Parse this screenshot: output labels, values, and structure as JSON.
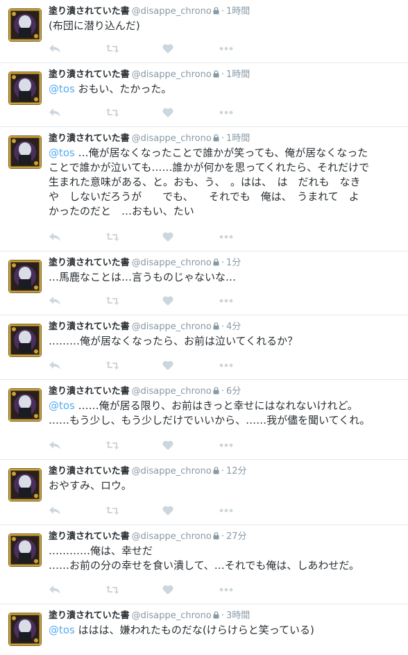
{
  "user": {
    "fullname": "塗り潰されていた書",
    "screenname": "@disappe_chrono"
  },
  "separator": "·",
  "colors": {
    "link": "#55acee",
    "meta": "#8899a6",
    "action_icon": "#ccd6dd",
    "divider": "#e1e8ed",
    "text": "#292f33"
  },
  "icons": [
    "lock-icon",
    "reply-icon",
    "retweet-icon",
    "like-icon",
    "more-icon"
  ],
  "tweets": [
    {
      "time": "1時間",
      "mention": "",
      "text": "(布団に潜り込んだ)"
    },
    {
      "time": "1時間",
      "mention": "@tos",
      "text": " おもい、たかった。"
    },
    {
      "time": "1時間",
      "mention": "@tos",
      "text": " …俺が居なくなったことで誰かが笑っても、俺が居なくなった\nことで誰かが泣いても……誰かが何かを思ってくれたら、それだけで\n生まれた意味がある、と。おも、う、　。はは、　は　だれも　なき\nや　しないだろうが　　でも、　　それでも　俺は、　うまれて　よ\nかったのだと　…おもい、たい"
    },
    {
      "time": "1分",
      "mention": "",
      "text": "…馬鹿なことは…言うものじゃないな…"
    },
    {
      "time": "4分",
      "mention": "",
      "text": "………俺が居なくなったら、お前は泣いてくれるか？"
    },
    {
      "time": "6分",
      "mention": "@tos",
      "text": " ……俺が居る限り、お前はきっと幸せにはなれないけれど。\n……もう少し、もう少しだけでいいから、……我が儘を聞いてくれ。"
    },
    {
      "time": "12分",
      "mention": "",
      "text": "おやすみ、ロウ。"
    },
    {
      "time": "27分",
      "mention": "",
      "text": "…………俺は、幸せだ\n……お前の分の幸せを食い潰して、…それでも俺は、しあわせだ。"
    },
    {
      "time": "3時間",
      "mention": "@tos",
      "text": " ははは、嫌われたものだな(けらけらと笑っている)"
    }
  ]
}
